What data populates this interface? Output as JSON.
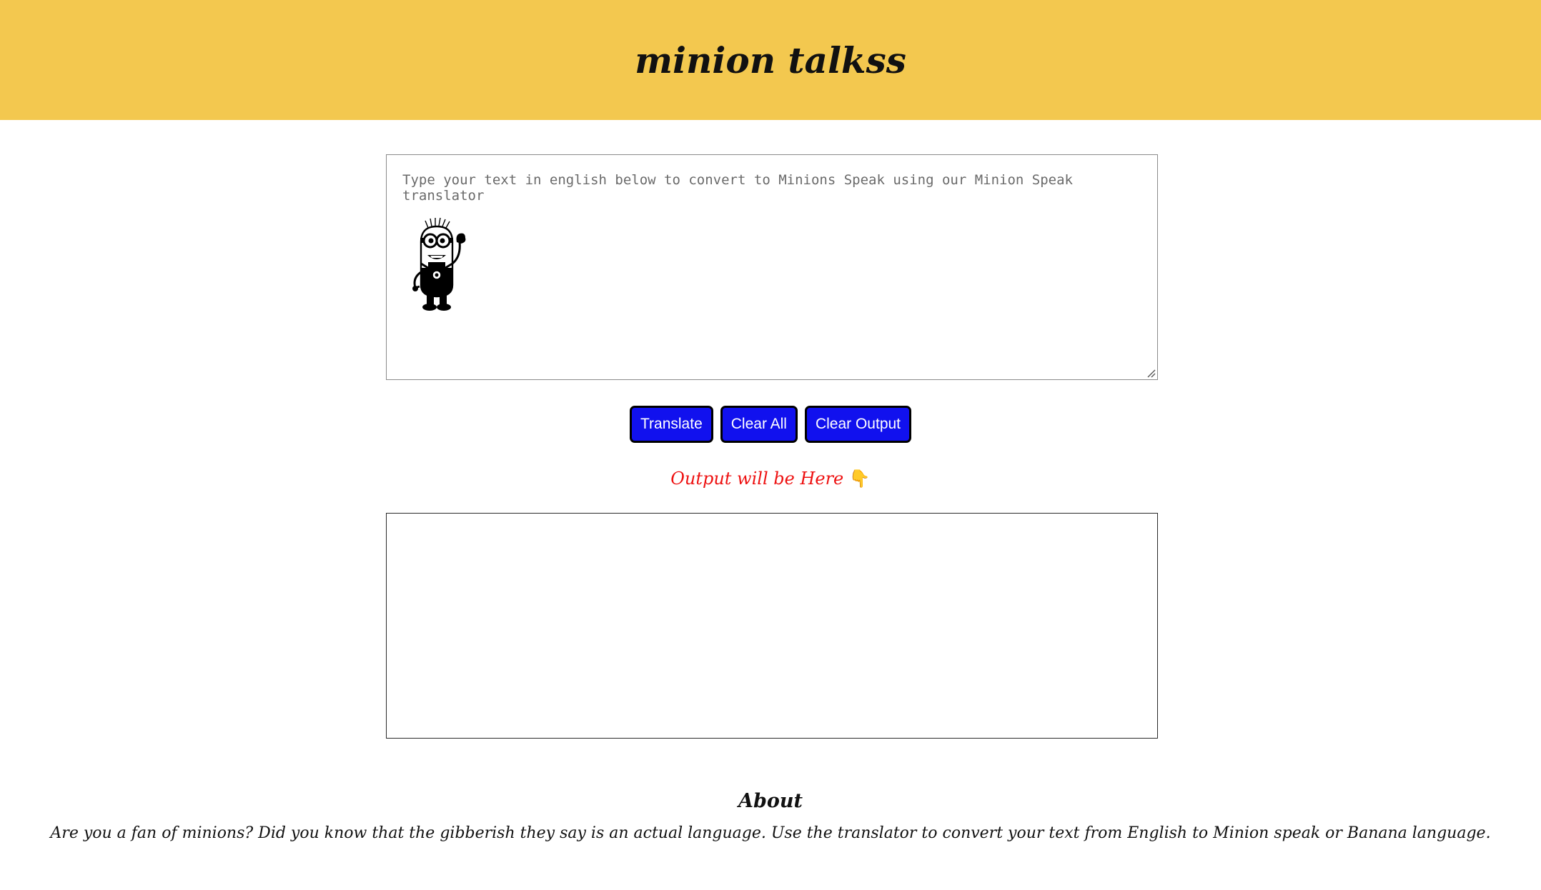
{
  "header": {
    "title": "minion talkss",
    "background": "#f3c84f"
  },
  "input": {
    "placeholder": "Type your text in english below to convert to Minions Speak using our Minion Speak translator",
    "value": "",
    "decoration": "minion-icon"
  },
  "buttons": {
    "translate_label": "Translate",
    "clear_all_label": "Clear All",
    "clear_output_label": "Clear Output",
    "color": "#1111ee"
  },
  "output": {
    "label": "Output will be Here",
    "label_icon": "pointing-down-icon",
    "label_color": "#ee1111",
    "value": ""
  },
  "about": {
    "title": "About",
    "text": "Are you a fan of minions? Did you know that the gibberish they say is an actual language. Use the translator to convert your text from English to Minion speak or Banana language."
  }
}
